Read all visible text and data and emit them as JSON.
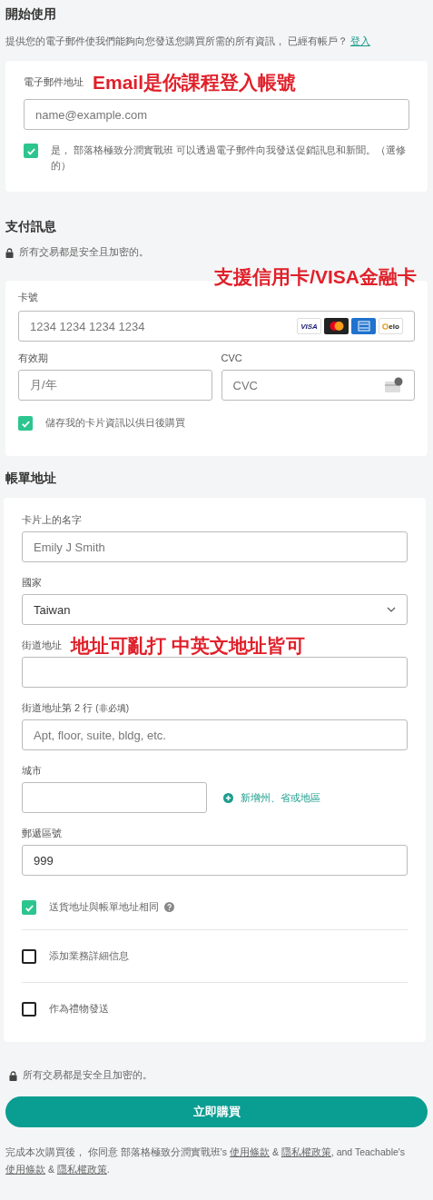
{
  "get_started": {
    "heading": "開始使用",
    "description": "提供您的電子郵件使我們能夠向您發送您購買所需的所有資訊， 已經有帳戶？",
    "login_link": "登入",
    "email": {
      "label": "電子郵件地址",
      "placeholder": "name@example.com"
    },
    "annotation": "Email是你課程登入帳號",
    "marketing_opt_in": {
      "label": "是， 部落格極致分潤實戰班 可以透過電子郵件向我發送促銷訊息和新聞。（選修的）",
      "checked": true
    }
  },
  "payment": {
    "heading": "支付訊息",
    "secure_note": "所有交易都是安全且加密的。",
    "annotation": "支援信用卡/VISA金融卡",
    "card_number": {
      "label": "卡號",
      "placeholder": "1234 1234 1234 1234"
    },
    "card_brands": [
      {
        "kind": "visa",
        "text": "VISA"
      },
      {
        "kind": "mastercard"
      },
      {
        "kind": "amex"
      },
      {
        "kind": "elo",
        "text": "elo"
      }
    ],
    "expiry": {
      "label": "有效期",
      "placeholder": "月/年"
    },
    "cvc": {
      "label": "CVC",
      "placeholder": "CVC"
    },
    "save_card": {
      "label": "儲存我的卡片資訊以供日後購買",
      "checked": true
    }
  },
  "billing": {
    "heading": "帳單地址",
    "fields": [
      {
        "kind": "text",
        "label": "卡片上的名字",
        "placeholder": "Emily J Smith"
      },
      {
        "kind": "select",
        "label": "國家",
        "value": "Taiwan"
      },
      {
        "kind": "text",
        "label": "街道地址",
        "annotation": "地址可亂打 中英文地址皆可"
      },
      {
        "kind": "text",
        "label": "街道地址第 2 行",
        "optional_note": "(非必填)",
        "placeholder": "Apt, floor, suite, bldg, etc."
      },
      {
        "kind": "city",
        "label": "城市",
        "side_link": "新增州、省或地區"
      },
      {
        "kind": "text",
        "label": "郵遞區號",
        "value": "999"
      }
    ],
    "options": [
      {
        "label": "送貨地址與帳單地址相同",
        "checked": true,
        "help": true
      },
      {
        "label": "添加業務詳細信息",
        "checked": false
      },
      {
        "label": "作為禮物發送",
        "checked": false
      }
    ]
  },
  "footer": {
    "secure_note": "所有交易都是安全且加密的。",
    "purchase_button": "立即購買",
    "terms": [
      {
        "kind": "text",
        "text": "完成本次購買後， 你同意 部落格極致分潤實戰班's "
      },
      {
        "kind": "link",
        "text": "使用條款"
      },
      {
        "kind": "text",
        "text": " & "
      },
      {
        "kind": "link",
        "text": "隱私權政策"
      },
      {
        "kind": "text",
        "text": ", and Teachable's "
      },
      {
        "kind": "link",
        "text": "使用條款"
      },
      {
        "kind": "text",
        "text": " & "
      },
      {
        "kind": "link",
        "text": "隱私權政策"
      },
      {
        "kind": "text",
        "text": "."
      }
    ]
  }
}
